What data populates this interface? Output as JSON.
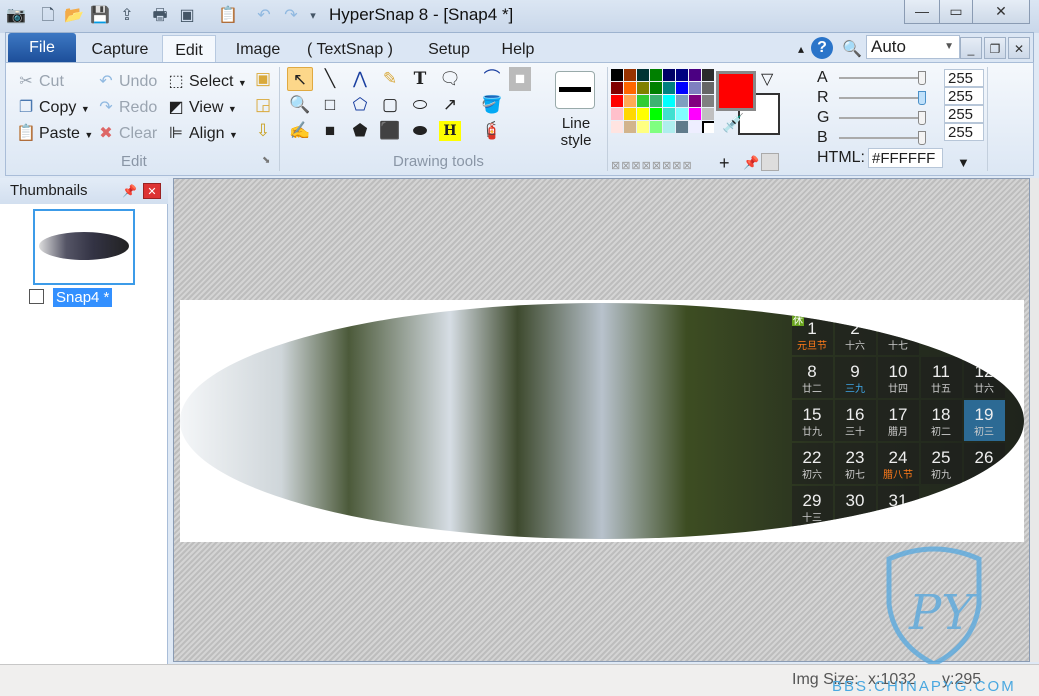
{
  "window": {
    "title": "HyperSnap 8 - [Snap4 *]",
    "min": "—",
    "max": "▭",
    "close": "✕"
  },
  "quick_access": [
    "camera-icon",
    "new-icon",
    "open-icon",
    "save-icon",
    "upload-icon",
    "print-icon",
    "screens-icon",
    "clipboard-icon",
    "undo-icon",
    "redo-icon",
    "customize-icon"
  ],
  "tabs": {
    "file": "File",
    "items": [
      "Capture",
      "Edit",
      "Image",
      "( TextSnap )",
      "Setup",
      "Help"
    ],
    "active": "Edit"
  },
  "zoom": {
    "value": "Auto"
  },
  "edit_group": {
    "label": "Edit",
    "cut": "Cut",
    "copy": "Copy",
    "paste": "Paste",
    "undo": "Undo",
    "redo": "Redo",
    "clear": "Clear",
    "select": "Select",
    "view": "View",
    "align": "Align"
  },
  "drawing_group": {
    "label": "Drawing tools",
    "line_style": "Line style"
  },
  "colors": {
    "foreground": "#FF0000",
    "background": "#FFFFFF",
    "palette": [
      "#000000",
      "#993300",
      "#003333",
      "#008000",
      "#000066",
      "#000080",
      "#4B0082",
      "#2B2B2B",
      "#800000",
      "#FF6600",
      "#808000",
      "#008000",
      "#008080",
      "#0000FF",
      "#7F7FC0",
      "#666666",
      "#FF0000",
      "#FFAA55",
      "#33CC33",
      "#3CB371",
      "#00FFFF",
      "#7F9FBF",
      "#800080",
      "#808080",
      "#FFC0CB",
      "#FFD700",
      "#FFFF00",
      "#00FF00",
      "#40E0D0",
      "#80FFFF",
      "#FF00FF",
      "#C0C0C0",
      "#FFE4E1",
      "#D2B48C",
      "#FFFF80",
      "#80FF80",
      "#AFEEEE",
      "#607B8B",
      "#EEEEFF"
    ]
  },
  "argb": {
    "a_label": "A",
    "r_label": "R",
    "g_label": "G",
    "b_label": "B",
    "a": "255",
    "r": "255",
    "g": "255",
    "b": "255",
    "html_label": "HTML:",
    "html": "#FFFFFF"
  },
  "thumbnails": {
    "title": "Thumbnails",
    "items": [
      {
        "label": "Snap4 *",
        "checked": false
      }
    ]
  },
  "calendar": [
    {
      "d": "1",
      "s": "元旦节",
      "c": "#ff7a1a"
    },
    {
      "d": "2",
      "s": "十六"
    },
    {
      "d": "",
      "s": "十七"
    },
    {
      "d": "8",
      "s": "廿二"
    },
    {
      "d": "9",
      "s": "三九",
      "c": "#3fa7e8"
    },
    {
      "d": "10",
      "s": "廿四"
    },
    {
      "d": "11",
      "s": "廿五"
    },
    {
      "d": "12",
      "s": "廿六"
    },
    {
      "d": "15",
      "s": "廿九"
    },
    {
      "d": "16",
      "s": "三十"
    },
    {
      "d": "17",
      "s": "腊月"
    },
    {
      "d": "18",
      "s": "初二"
    },
    {
      "d": "19",
      "s": "初三",
      "sel": true
    },
    {
      "d": "22",
      "s": "初六"
    },
    {
      "d": "23",
      "s": "初七"
    },
    {
      "d": "24",
      "s": "腊八节",
      "c": "#ff7a1a"
    },
    {
      "d": "25",
      "s": "初九"
    },
    {
      "d": "26",
      "s": ""
    },
    {
      "d": "29",
      "s": "十三"
    },
    {
      "d": "30",
      "s": ""
    },
    {
      "d": "31",
      "s": ""
    }
  ],
  "holiday_badge": "休",
  "status": {
    "img_size": "Img Size:",
    "x": "x:1032",
    "y": "y:295"
  },
  "watermark": "BBS.CHINAPYG.COM"
}
